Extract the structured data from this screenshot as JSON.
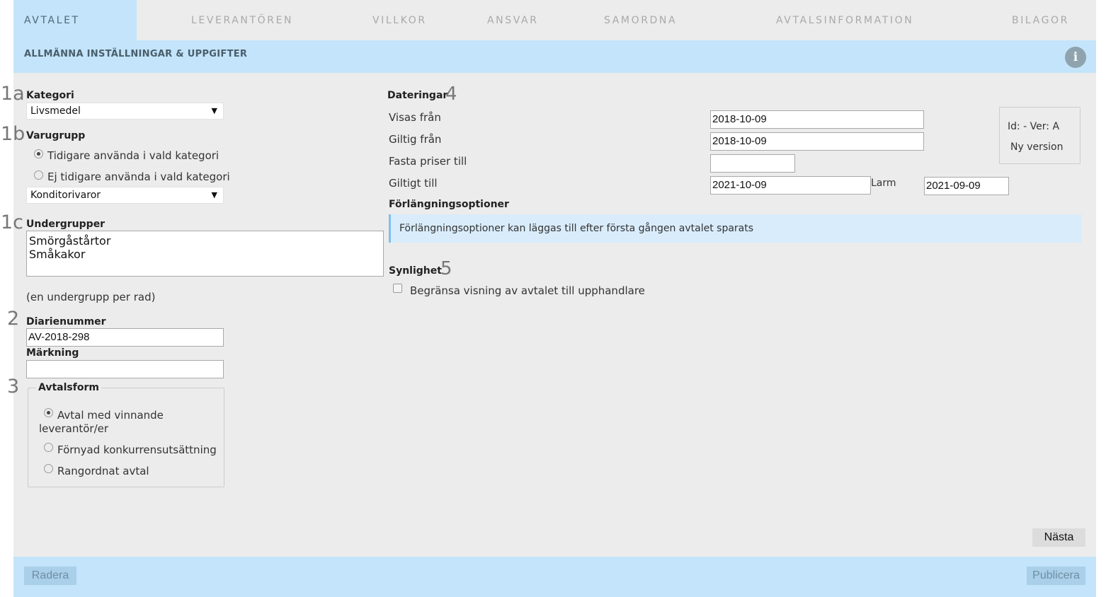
{
  "tabs": [
    {
      "label": "AVTALET",
      "active": true
    },
    {
      "label": "LEVERANTÖREN",
      "active": false
    },
    {
      "label": "VILLKOR",
      "active": false
    },
    {
      "label": "ANSVAR",
      "active": false
    },
    {
      "label": "SAMORDNA",
      "active": false
    },
    {
      "label": "AVTALSINFORMATION",
      "active": false
    },
    {
      "label": "BILAGOR",
      "active": false
    }
  ],
  "section": {
    "title": "ALLMÄNNA INSTÄLLNINGAR & UPPGIFTER",
    "info_icon": "info-icon"
  },
  "left": {
    "kategori": {
      "num": "1a",
      "label": "Kategori",
      "value": "Livsmedel"
    },
    "varugrupp": {
      "num": "1b",
      "label": "Varugrupp",
      "options": [
        {
          "label": "Tidigare använda i vald kategori",
          "checked": true
        },
        {
          "label": "Ej tidigare använda i vald kategori",
          "checked": false
        }
      ],
      "value": "Konditorivaror"
    },
    "undergrupper": {
      "num": "1c",
      "label": "Undergrupper",
      "lines": [
        "Smörgåstårtor",
        "Småkakor"
      ],
      "hint": "(en undergrupp per rad)"
    },
    "diarienummer": {
      "num": "2",
      "label": "Diarienummer",
      "value": "AV-2018-298"
    },
    "markning": {
      "label": "Märkning",
      "value": ""
    },
    "avtalsform": {
      "num": "3",
      "legend": "Avtalsform",
      "options": [
        {
          "label_line1": "Avtal med vinnande",
          "label_line2": "leverantör/er",
          "checked": true
        },
        {
          "label_line1": "Förnyad konkurrensutsättning",
          "checked": false
        },
        {
          "label_line1": "Rangordnat avtal",
          "checked": false
        }
      ]
    }
  },
  "right": {
    "dateringar": {
      "label": "Dateringar",
      "num": "4",
      "visas_fran": {
        "label": "Visas från",
        "value": "2018-10-09"
      },
      "giltig_fran": {
        "label": "Giltig från",
        "value": "2018-10-09"
      },
      "fasta_priser": {
        "label": "Fasta priser till",
        "value": ""
      },
      "giltigt_till": {
        "label": "Giltigt till",
        "value": "2021-10-09"
      },
      "larm": {
        "label": "Larm",
        "value": "2021-09-09"
      }
    },
    "id_box": {
      "line1": "Id: - Ver: A",
      "line2": "Ny version"
    },
    "forlangning": {
      "label": "Förlängningsoptioner",
      "message": "Förlängningsoptioner kan läggas till efter första gången avtalet sparats"
    },
    "synlighet": {
      "label": "Synlighet",
      "num": "5",
      "checkbox_label": "Begränsa visning av avtalet till upphandlare",
      "checked": false
    }
  },
  "buttons": {
    "next": "Nästa",
    "delete": "Radera",
    "publish": "Publicera"
  },
  "colors": {
    "tab_active_bg": "#c3e4fa",
    "panel_bg": "#ececec",
    "accent": "#7fc0ec"
  }
}
